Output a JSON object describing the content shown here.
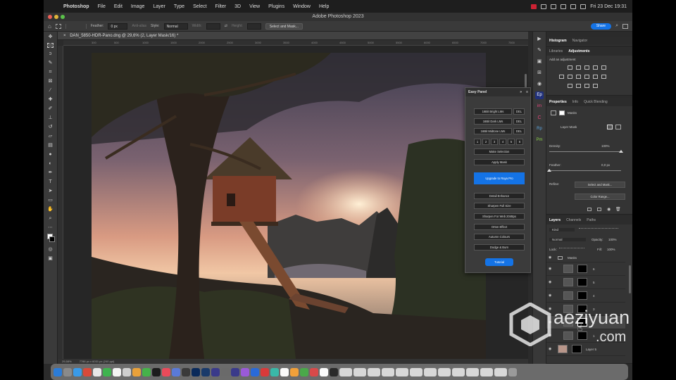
{
  "menubar": {
    "app": "Photoshop",
    "items": [
      "File",
      "Edit",
      "Image",
      "Layer",
      "Type",
      "Select",
      "Filter",
      "3D",
      "View",
      "Plugins",
      "Window",
      "Help"
    ],
    "clock": "Fri 23 Dec  19:31"
  },
  "window": {
    "title": "Adobe Photoshop 2023"
  },
  "options": {
    "feather_label": "Feather:",
    "feather_value": "0 px",
    "antialias": "Anti-alias",
    "style_label": "Style:",
    "style_value": "Normal",
    "width_label": "Width:",
    "height_label": "Height:",
    "select_mask": "Select and Mask...",
    "share": "Share"
  },
  "document": {
    "tab": "DAN_5850-HDR-Pano.dng @ 29,6% (2, Layer Mask/16) *",
    "zoom": "29,58%",
    "info": "7786 px x 6031 px (240 ppi)",
    "ruler_ticks": [
      "300",
      "500",
      "1000",
      "1500",
      "2000",
      "2500",
      "3000",
      "3500",
      "4000",
      "4500",
      "5000",
      "5500",
      "6000",
      "6500",
      "7000",
      "7500"
    ]
  },
  "easy_panel": {
    "title": "Easy Panel",
    "rows": [
      {
        "label": "16Bit Bright LMs",
        "del": "DEL"
      },
      {
        "label": "16Bit Dark LMs",
        "del": "DEL"
      },
      {
        "label": "16Bit Midtone LMs",
        "del": "DEL"
      }
    ],
    "numbers": [
      "1",
      "2",
      "3",
      "4",
      "5",
      "6"
    ],
    "make_selection": "Make Selection",
    "apply_mask": "Apply Mask",
    "upgrade": "Upgrade to Raya Pro",
    "actions": [
      "Detail Enhance",
      "Sharpen Full Size",
      "Sharpen For Web 2048px",
      "Orton Effect",
      "Autumn Colours",
      "Dodge & Burn"
    ],
    "tutorial": "Tutorial"
  },
  "right_strip": {
    "icons": [
      "Ep",
      "im",
      "C",
      "Rp",
      "Pm"
    ]
  },
  "histogram_panel": {
    "tabs": [
      "Histogram",
      "Navigator"
    ]
  },
  "adjustments_panel": {
    "tabs": [
      "Libraries",
      "Adjustments"
    ],
    "hint": "Add an adjustment"
  },
  "properties_panel": {
    "tabs": [
      "Properties",
      "Info",
      "Quick Blending"
    ],
    "masks_label": "Masks",
    "layer_mask": "Layer Mask",
    "density_label": "Density:",
    "density_value": "100%",
    "density_level": 1.0,
    "feather_label": "Feather:",
    "feather_value": "0,0 px",
    "feather_level": 0.0,
    "refine_label": "Refine:",
    "select_mask": "Select and Mask...",
    "color_range": "Color Range..."
  },
  "layers_panel": {
    "tabs": [
      "Layers",
      "Channels",
      "Paths"
    ],
    "kind": "Kind",
    "blend_mode": "Normal",
    "opacity_label": "Opacity:",
    "opacity_value": "100%",
    "lock_label": "Lock:",
    "fill_label": "Fill:",
    "fill_value": "100%",
    "group": "Masks",
    "layers": [
      {
        "name": "6"
      },
      {
        "name": "5"
      },
      {
        "name": "4"
      },
      {
        "name": "3"
      },
      {
        "name": "2"
      },
      {
        "name": "1"
      },
      {
        "name": "Layer 5"
      }
    ]
  },
  "watermark": {
    "line1": "aeziyuan",
    "line2": ".com"
  },
  "colors": {
    "accent": "#1473e6",
    "panel": "#343434",
    "canvas": "#262626",
    "dock": "#6b6b6b"
  }
}
